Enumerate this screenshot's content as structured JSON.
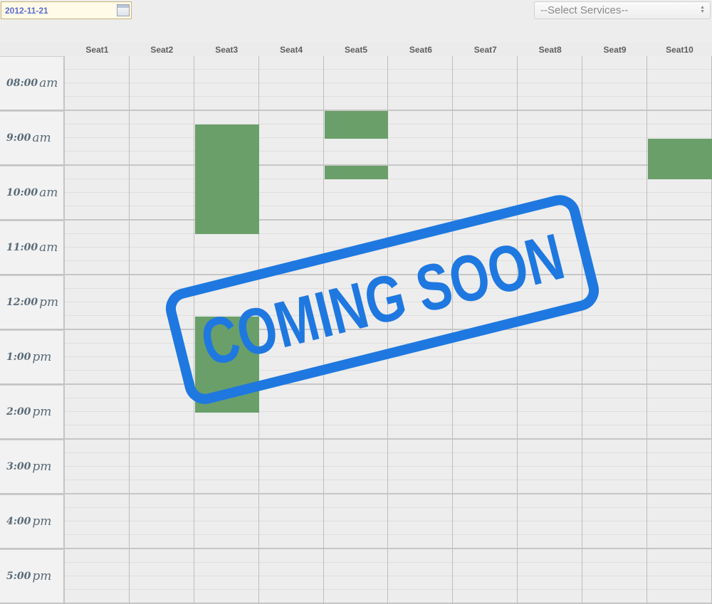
{
  "date_picker": {
    "value": "2012-11-21"
  },
  "services_select": {
    "selected": "--Select Services--"
  },
  "seats": [
    "Seat1",
    "Seat2",
    "Seat3",
    "Seat4",
    "Seat5",
    "Seat6",
    "Seat7",
    "Seat8",
    "Seat9",
    "Seat10"
  ],
  "times": [
    {
      "num": "08:00",
      "suffix": "am"
    },
    {
      "num": "9:00",
      "suffix": "am"
    },
    {
      "num": "10:00",
      "suffix": "am"
    },
    {
      "num": "11:00",
      "suffix": "am"
    },
    {
      "num": "12:00",
      "suffix": "pm"
    },
    {
      "num": "1:00",
      "suffix": "pm"
    },
    {
      "num": "2:00",
      "suffix": "pm"
    },
    {
      "num": "3:00",
      "suffix": "pm"
    },
    {
      "num": "4:00",
      "suffix": "pm"
    },
    {
      "num": "5:00",
      "suffix": "pm"
    }
  ],
  "bookings": [
    {
      "seat": "Seat3",
      "start": "9:15",
      "end": "11:15"
    },
    {
      "seat": "Seat3",
      "start": "12:45",
      "end": "2:30"
    },
    {
      "seat": "Seat5",
      "start": "9:00",
      "end": "9:30"
    },
    {
      "seat": "Seat5",
      "start": "10:00",
      "end": "10:15"
    },
    {
      "seat": "Seat10",
      "start": "9:30",
      "end": "10:15"
    }
  ],
  "stamp": {
    "text": "COMING SOON",
    "color": "#1e78e0"
  },
  "colors": {
    "booking": "#6a9f6a"
  }
}
